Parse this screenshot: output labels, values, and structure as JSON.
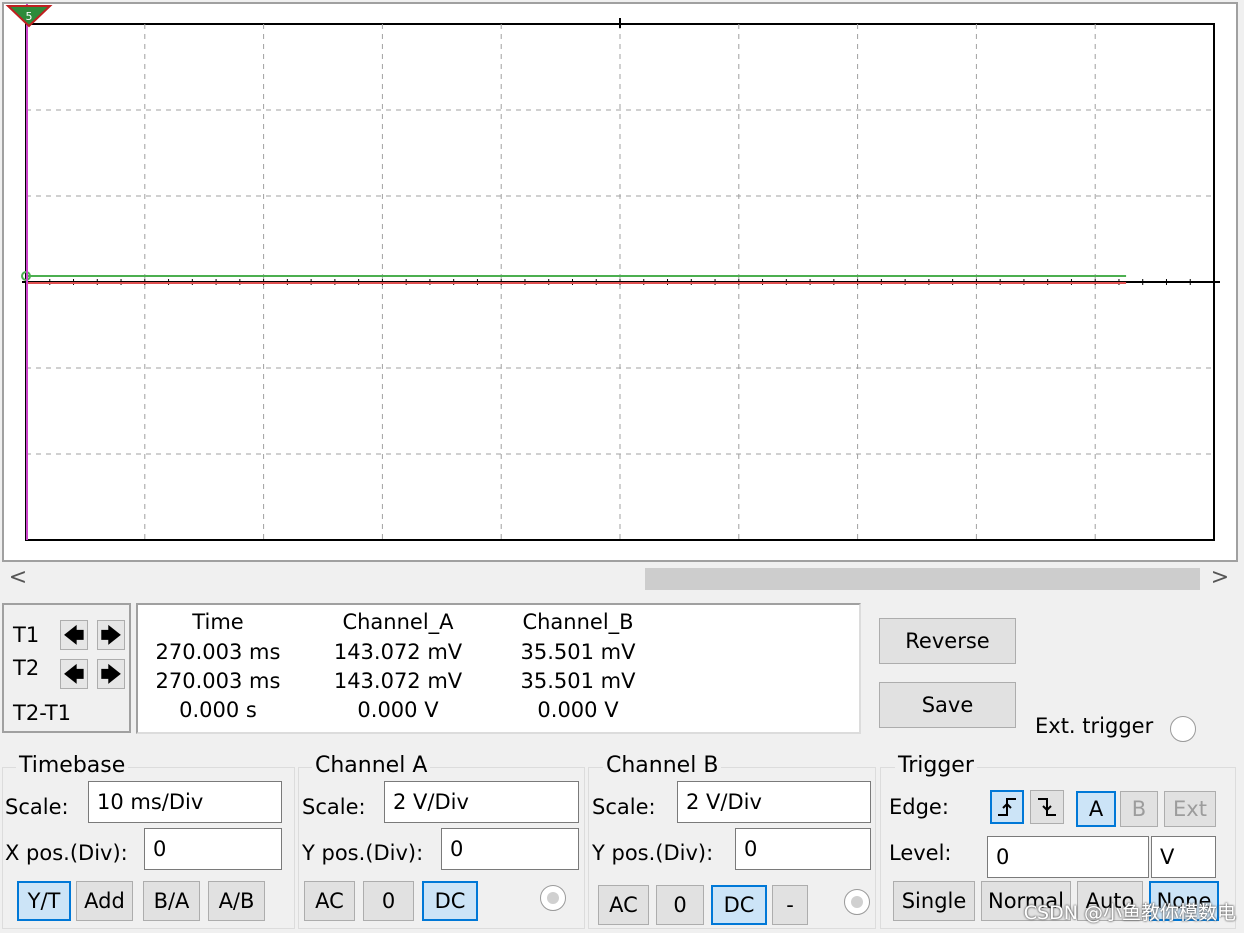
{
  "screen": {
    "trigger_marker": "5",
    "colors": {
      "grid": "#a0a0a0",
      "channel_a": "#4caf50",
      "channel_b": "#e05050",
      "cursor": "#cc44cc",
      "axis": "#000000"
    }
  },
  "scrollbar": {
    "left_arrow": "<",
    "right_arrow": ">"
  },
  "cursors": {
    "t1_label": "T1",
    "t2_label": "T2",
    "diff_label": "T2-T1",
    "left_arrow": "🡄",
    "right_arrow": "🡆"
  },
  "readout": {
    "headers": [
      "Time",
      "Channel_A",
      "Channel_B"
    ],
    "rows": [
      [
        "270.003 ms",
        "143.072 mV",
        "35.501 mV"
      ],
      [
        "270.003 ms",
        "143.072 mV",
        "35.501 mV"
      ],
      [
        "0.000 s",
        "0.000 V",
        "0.000 V"
      ]
    ]
  },
  "actions": {
    "reverse": "Reverse",
    "save": "Save",
    "ext_trigger": "Ext. trigger"
  },
  "timebase": {
    "title": "Timebase",
    "scale_label": "Scale:",
    "scale_value": "10 ms/Div",
    "xpos_label": "X pos.(Div):",
    "xpos_value": "0",
    "modes": [
      "Y/T",
      "Add",
      "B/A",
      "A/B"
    ]
  },
  "channel_a": {
    "title": "Channel A",
    "scale_label": "Scale:",
    "scale_value": "2  V/Div",
    "ypos_label": "Y pos.(Div):",
    "ypos_value": "0",
    "coupling": [
      "AC",
      "0",
      "DC"
    ]
  },
  "channel_b": {
    "title": "Channel B",
    "scale_label": "Scale:",
    "scale_value": "2  V/Div",
    "ypos_label": "Y pos.(Div):",
    "ypos_value": "0",
    "coupling": [
      "AC",
      "0",
      "DC",
      "-"
    ]
  },
  "trigger": {
    "title": "Trigger",
    "edge_label": "Edge:",
    "level_label": "Level:",
    "level_value": "0",
    "level_unit": "V",
    "sources": [
      "A",
      "B",
      "Ext"
    ],
    "modes": [
      "Single",
      "Normal",
      "Auto",
      "None"
    ]
  },
  "watermark": "CSDN @小鱼教你模数电"
}
